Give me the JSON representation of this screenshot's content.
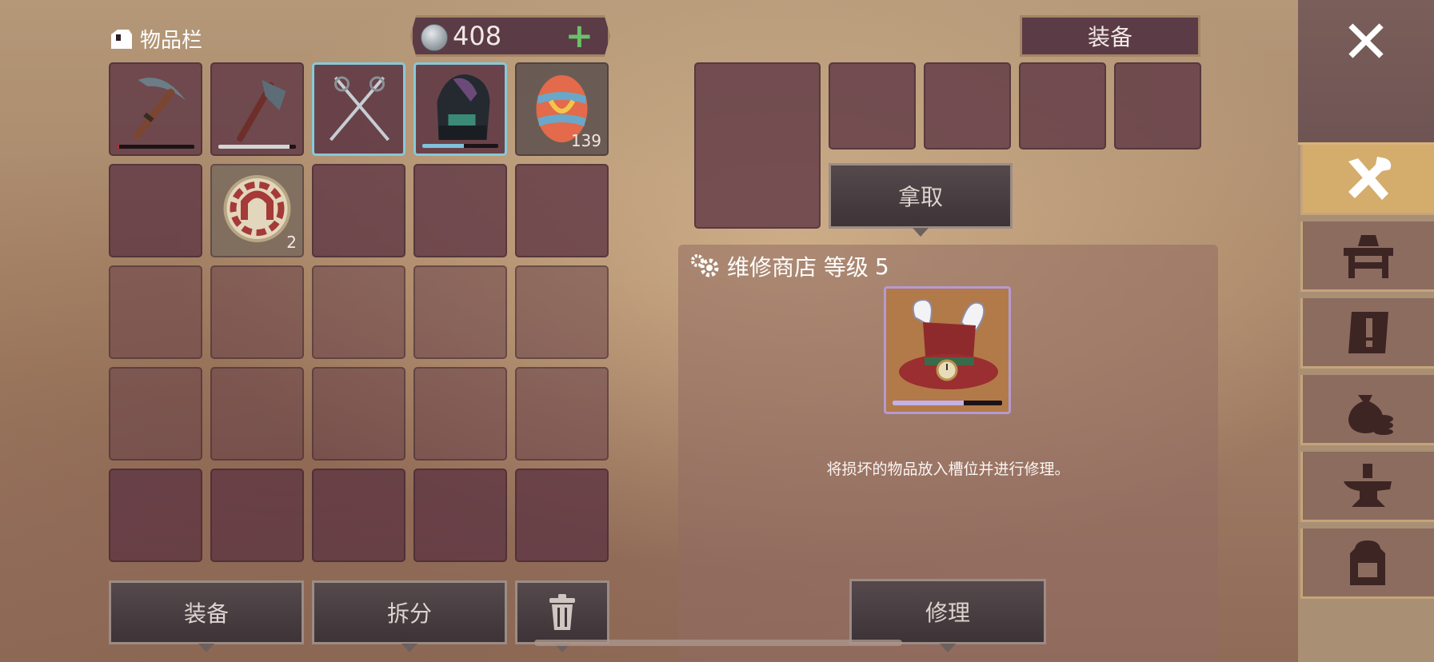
{
  "inventory": {
    "title": "物品栏",
    "currency": "408"
  },
  "inventory_items": [
    {
      "name": "pickaxe",
      "durability": 0.03,
      "color": "#c2273b"
    },
    {
      "name": "hatchet",
      "durability": 0.92,
      "color": "#d5d5d5"
    },
    {
      "name": "crossed-swords"
    },
    {
      "name": "backpack",
      "durability": 0.55,
      "color": "#7fc3dc"
    },
    {
      "name": "easter-egg",
      "quantity": "139"
    },
    {
      "name": "horseshoe-token",
      "quantity": "2"
    }
  ],
  "equipment": {
    "title": "装备",
    "take_button": "拿取"
  },
  "repair_shop": {
    "title": "维修商店 等级",
    "level": "5",
    "slot_item": "rabbit-top-hat",
    "durability": 0.65,
    "description": "将损坏的物品放入槽位并进行修理。",
    "repair_button": "修理"
  },
  "actions": {
    "equip": "装备",
    "split": "拆分"
  },
  "sidebar": {
    "tabs": [
      {
        "icon": "tools-icon",
        "active": true
      },
      {
        "icon": "workbench-icon",
        "active": false
      },
      {
        "icon": "quest-book-icon",
        "active": false
      },
      {
        "icon": "money-bag-icon",
        "active": false
      },
      {
        "icon": "anvil-icon",
        "active": false
      },
      {
        "icon": "backpack-icon",
        "active": false
      }
    ]
  },
  "colors": {
    "slot": "#5c3442",
    "accent_green": "#6cc06a",
    "panel_gold": "#d4ad6c"
  }
}
